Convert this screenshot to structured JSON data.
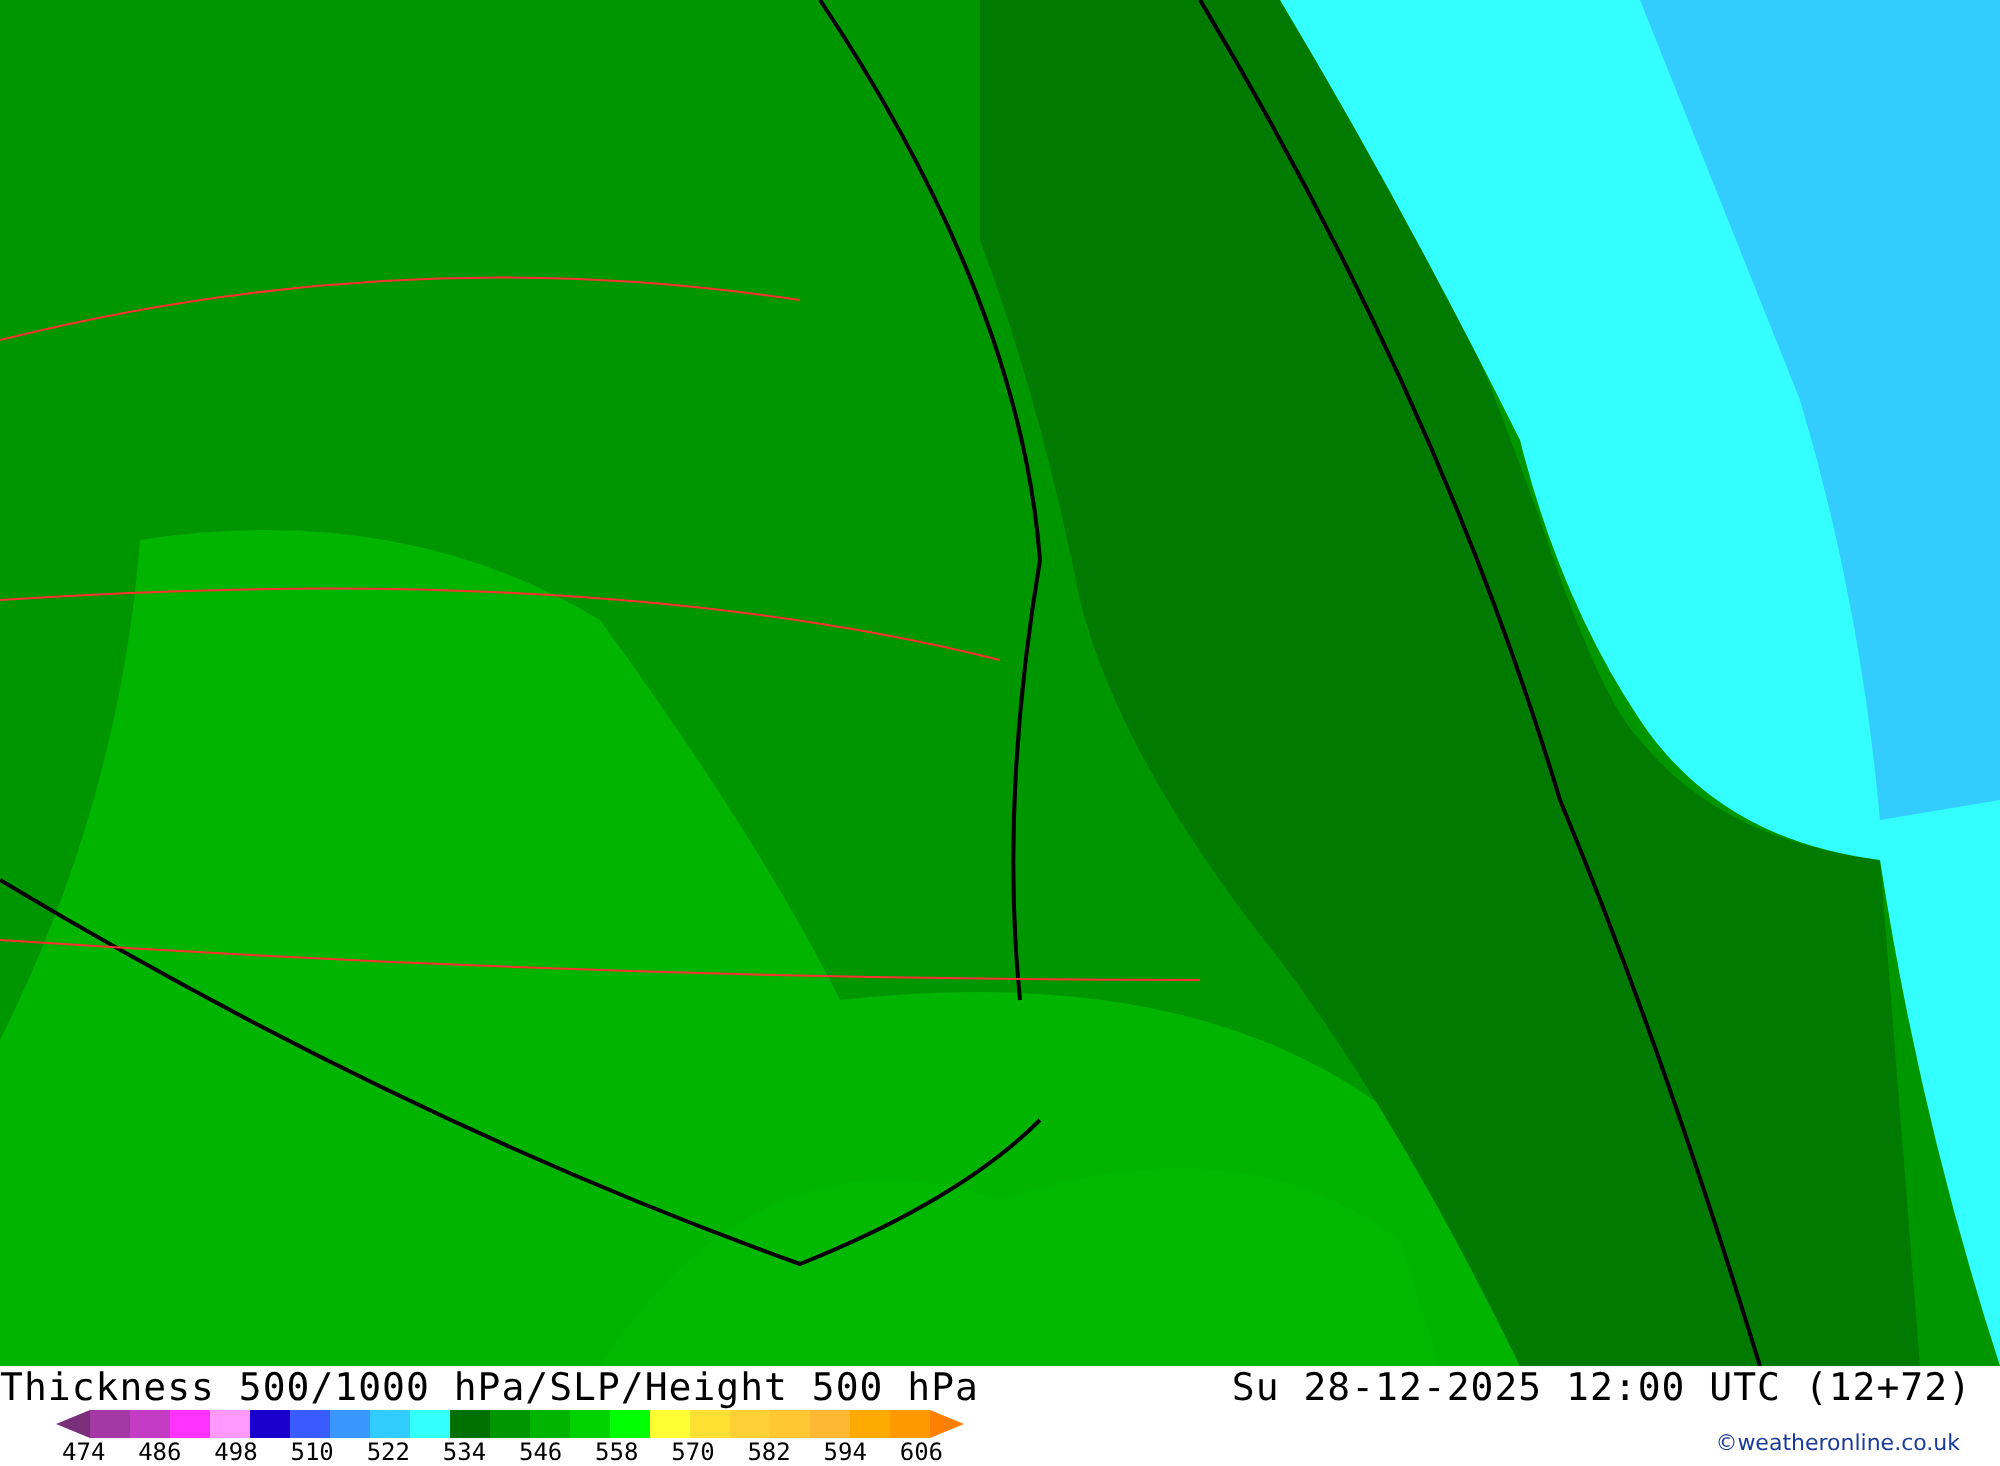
{
  "title": "Thickness 500/1000 hPa/SLP/Height 500 hPa",
  "valid_time": "Su 28-12-2025 12:00 UTC (12+72)",
  "legend": {
    "swatches": [
      {
        "color": "#7a2f7a"
      },
      {
        "color": "#a33aa3"
      },
      {
        "color": "#c43cc4"
      },
      {
        "color": "#ff33ff"
      },
      {
        "color": "#ff99ff"
      },
      {
        "color": "#1a00cc"
      },
      {
        "color": "#3a5cff"
      },
      {
        "color": "#3a96ff"
      },
      {
        "color": "#33ccff"
      },
      {
        "color": "#33ffff"
      },
      {
        "color": "#007000"
      },
      {
        "color": "#009600"
      },
      {
        "color": "#00b400"
      },
      {
        "color": "#00d200"
      },
      {
        "color": "#00ff00"
      },
      {
        "color": "#ffff33"
      },
      {
        "color": "#ffe033"
      },
      {
        "color": "#ffd033"
      },
      {
        "color": "#ffc833"
      },
      {
        "color": "#ffb833"
      },
      {
        "color": "#ffaa00"
      },
      {
        "color": "#ff9900"
      },
      {
        "color": "#ff7f00"
      }
    ],
    "labels": [
      "474",
      "486",
      "498",
      "510",
      "522",
      "534",
      "546",
      "558",
      "570",
      "582",
      "594",
      "606"
    ]
  },
  "copyright": "©weatheronline.co.uk"
}
